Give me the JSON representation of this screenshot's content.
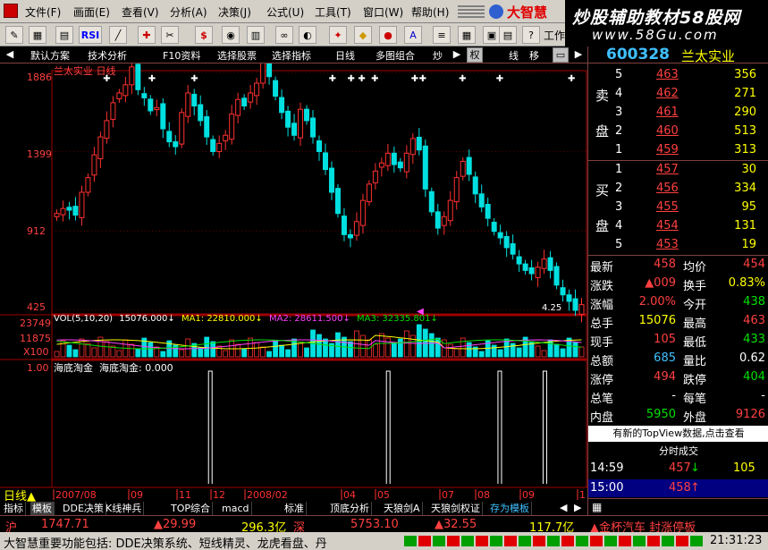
{
  "menu": {
    "items": [
      "文件(F)",
      "画面(E)",
      "查看(V)",
      "分析(A)",
      "决策(J)",
      "公式(U)",
      "工具(T)",
      "窗口(W)",
      "帮助(H)"
    ],
    "brand": "大智慧"
  },
  "watermark": {
    "line1": "炒股辅助教材58股网",
    "line2": "www.58Gu.com"
  },
  "toolbar": {
    "rsi": "RSI",
    "work": "工作"
  },
  "tabs": {
    "items": [
      "默认方案",
      "技术分析",
      "F10资料",
      "选择股票",
      "选择指标",
      "日线",
      "多图组合",
      "炒"
    ],
    "quan": "权",
    "xian": "线",
    "yi": "移"
  },
  "chart": {
    "title": "兰太实业 日线",
    "price_ticks": [
      "1886",
      "1399",
      "912",
      "425"
    ],
    "low_label": "4.25",
    "vol_ticks": [
      "23749",
      "11875",
      "X100"
    ],
    "vol_legend": {
      "params": "VOL(5,10,20)",
      "v": "15076.000",
      "ma1": "MA1: 22810.000",
      "ma2": "MA2: 28611.500",
      "ma3": "MA3: 32335.801"
    },
    "ind_tick": "1.00",
    "ind_legend": "海底淘金  海底淘金: 0.000",
    "x_labels": [
      "2007/08",
      "09",
      "11",
      "12",
      "2008/02",
      "04",
      "05",
      "07",
      "08",
      "09",
      "1"
    ]
  },
  "chart_data": {
    "type": "candlestick",
    "title": "兰太实业 日线",
    "price_axis": {
      "ticks": [
        18.86,
        13.99,
        9.12,
        4.25
      ],
      "unit": "price"
    },
    "volume_axis": {
      "ticks": [
        23749,
        11875
      ],
      "unit": "x100"
    },
    "close_series": [
      10.2,
      10.5,
      10.4,
      10.1,
      11.5,
      12.4,
      13.8,
      14.9,
      15.9,
      17.0,
      17.6,
      18.1,
      19.2,
      17.8,
      17.3,
      16.5,
      16.7,
      15.4,
      14.6,
      14.3,
      16.4,
      17.6,
      16.8,
      15.9,
      14.9,
      14.0,
      14.5,
      15.0,
      16.3,
      17.2,
      16.8,
      17.6,
      18.2,
      19.6,
      18.6,
      17.4,
      16.4,
      15.5,
      15.0,
      16.6,
      15.9,
      14.9,
      14.0,
      12.9,
      11.5,
      10.2,
      8.9,
      8.7,
      9.7,
      11.0,
      12.0,
      12.8,
      13.3,
      13.9,
      13.2,
      13.0,
      13.9,
      14.8,
      14.1,
      11.7,
      10.3,
      9.3,
      10.0,
      11.0,
      12.4,
      13.4,
      12.6,
      11.4,
      10.6,
      9.9,
      9.1,
      8.7,
      8.1,
      7.7,
      7.1,
      6.7,
      6.5,
      6.9,
      7.4,
      6.7,
      5.8,
      5.2,
      4.8,
      4.25,
      4.6
    ],
    "vol_legend": {
      "VOL": 15076.0,
      "MA1": 22810.0,
      "MA2": 28611.5,
      "MA3": 32335.801
    },
    "indicator": {
      "name": "海底淘金",
      "value": 0.0,
      "ytick": 1.0,
      "signals_at": [
        0.295,
        0.63,
        0.84,
        0.925
      ]
    },
    "x_labels": [
      "2007/08",
      "09",
      "11",
      "12",
      "2008/02",
      "04",
      "05",
      "07",
      "08",
      "09",
      "1"
    ]
  },
  "quote": {
    "code": "600328",
    "name": "兰太实业",
    "sell_label": [
      "卖",
      "盘"
    ],
    "buy_label": [
      "买",
      "盘"
    ],
    "asks": [
      {
        "n": "5",
        "p": "463",
        "v": "356"
      },
      {
        "n": "4",
        "p": "462",
        "v": "271"
      },
      {
        "n": "3",
        "p": "461",
        "v": "290"
      },
      {
        "n": "2",
        "p": "460",
        "v": "513"
      },
      {
        "n": "1",
        "p": "459",
        "v": "313"
      }
    ],
    "bids": [
      {
        "n": "1",
        "p": "457",
        "v": "30"
      },
      {
        "n": "2",
        "p": "456",
        "v": "334"
      },
      {
        "n": "3",
        "p": "455",
        "v": "95"
      },
      {
        "n": "4",
        "p": "454",
        "v": "131"
      },
      {
        "n": "5",
        "p": "453",
        "v": "19"
      }
    ],
    "stats": [
      {
        "l1": "最新",
        "v1": "458",
        "c1": "red",
        "l2": "均价",
        "v2": "454",
        "c2": "red"
      },
      {
        "l1": "涨跌",
        "v1": "▲009",
        "c1": "red",
        "l2": "换手",
        "v2": "0.83%",
        "c2": "yel"
      },
      {
        "l1": "涨幅",
        "v1": "2.00%",
        "c1": "red",
        "l2": "今开",
        "v2": "438",
        "c2": "grn"
      },
      {
        "l1": "总手",
        "v1": "15076",
        "c1": "yel",
        "l2": "最高",
        "v2": "463",
        "c2": "red"
      },
      {
        "l1": "现手",
        "v1": "105",
        "c1": "red",
        "l2": "最低",
        "v2": "433",
        "c2": "grn"
      },
      {
        "l1": "总额",
        "v1": "685",
        "c1": "cyn",
        "l2": "量比",
        "v2": "0.62",
        "c2": "wht"
      },
      {
        "l1": "涨停",
        "v1": "494",
        "c1": "red",
        "l2": "跌停",
        "v2": "404",
        "c2": "grn"
      },
      {
        "l1": "总笔",
        "v1": "-",
        "c1": "wht",
        "l2": "每笔",
        "v2": "-",
        "c2": "wht"
      },
      {
        "l1": "内盘",
        "v1": "5950",
        "c1": "grn",
        "l2": "外盘",
        "v2": "9126",
        "c2": "red"
      }
    ],
    "topview": "有新的TopView数据,点击查看",
    "ticks_title": "分时成交",
    "ticks": [
      {
        "t": "14:59",
        "p": "457",
        "arrow": "↓",
        "v": "105"
      },
      {
        "t": "15:00",
        "p": "458",
        "arrow": "↑",
        "v": ""
      }
    ]
  },
  "bottom_tabs": [
    "指标",
    "模板",
    "DDE决策",
    "K线神兵",
    "TOP综合",
    "macd",
    "标准",
    "顶底分析",
    "天狼剑A",
    "天狼剑权证",
    "存为模板"
  ],
  "status": {
    "sh_label": "沪",
    "sh_index": "1747.71",
    "sh_chg": "▲29.99",
    "sh_amt": "296.3亿",
    "sz_label": "深",
    "sz_index": "5753.10",
    "sz_chg": "▲32.55",
    "sz_amt": "117.7亿",
    "news": "▲金杯汽车 封涨停板",
    "ticker": "大智慧重要功能包括: DDE决策系统、短线精灵、龙虎看盘、丹",
    "time": "21:31:23"
  }
}
